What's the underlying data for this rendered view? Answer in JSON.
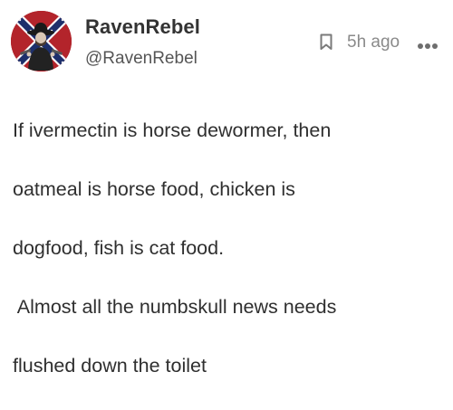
{
  "post": {
    "author": {
      "display_name": "RavenRebel",
      "handle": "@RavenRebel",
      "avatar_icon": "confederate-flag-cowboy-avatar"
    },
    "timestamp": "5h ago",
    "actions": {
      "bookmark_icon": "bookmark-icon",
      "more_icon": "more-options-icon"
    },
    "body_lines": [
      "If ivermectin is horse dewormer, then",
      "oatmeal is horse food, chicken is",
      "dogfood, fish is cat food.",
      " Almost all the numbskull news needs",
      "flushed down the toilet"
    ]
  },
  "colors": {
    "background": "#ffffff",
    "name_text": "#333333",
    "handle_text": "#555555",
    "meta_text": "#8a8a8a",
    "body_text": "#2f2f2f",
    "avatar_red": "#b3242b",
    "avatar_blue": "#1d2f6b"
  }
}
